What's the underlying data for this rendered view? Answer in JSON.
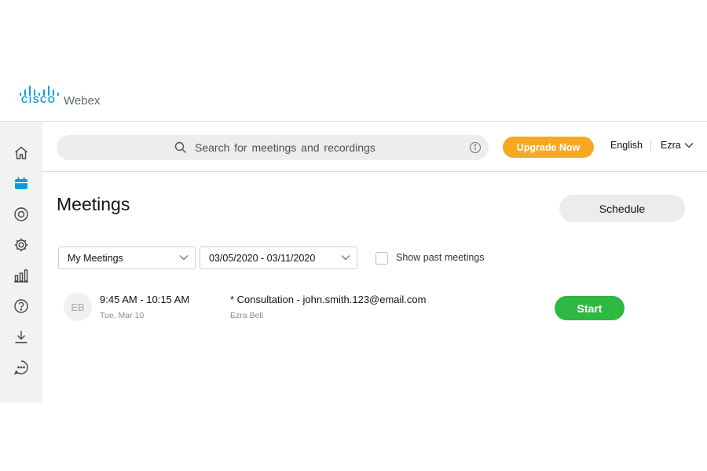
{
  "brand": {
    "cisco": "CISCO",
    "product": "Webex",
    "color": "#049fd9"
  },
  "sidebar": {
    "items": [
      {
        "name": "home",
        "icon": "home-icon",
        "active": false
      },
      {
        "name": "meetings",
        "icon": "calendar-icon",
        "active": true
      },
      {
        "name": "recordings",
        "icon": "record-icon",
        "active": false
      },
      {
        "name": "preferences",
        "icon": "gear-icon",
        "active": false
      },
      {
        "name": "insights",
        "icon": "bar-chart-icon",
        "active": false
      },
      {
        "name": "support",
        "icon": "help-icon",
        "active": false
      },
      {
        "name": "downloads",
        "icon": "download-icon",
        "active": false
      },
      {
        "name": "feedback",
        "icon": "chat-icon",
        "active": false
      }
    ]
  },
  "topbar": {
    "search_placeholder": "Search for meetings and recordings",
    "upgrade_label": "Upgrade Now",
    "language": "English",
    "user": "Ezra"
  },
  "main": {
    "title": "Meetings",
    "schedule_label": "Schedule",
    "filters": {
      "owner": "My Meetings",
      "date_range": "03/05/2020 - 03/11/2020",
      "show_past_label": "Show past meetings",
      "show_past_checked": false
    },
    "meetings": [
      {
        "initials": "EB",
        "time": "9:45 AM - 10:15 AM",
        "date": "Tue, Mar 10",
        "title": "* Consultation - john.smith.123@email.com",
        "host": "Ezra Bell",
        "action": "Start"
      }
    ]
  },
  "colors": {
    "accent": "#049fd9",
    "upgrade": "#f7a823",
    "start": "#2fb842"
  }
}
